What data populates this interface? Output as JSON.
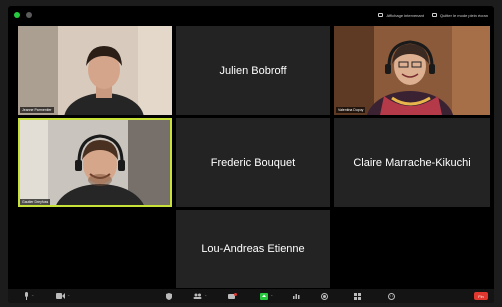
{
  "topbar": {
    "speaker_view_label": "Affichage intervenant",
    "exit_fullscreen_label": "Quitter le mode plein écran"
  },
  "participants": [
    {
      "name": "Jeanne Parmentier",
      "video": true
    },
    {
      "name": "Julien Bobroff",
      "video": false
    },
    {
      "name": "Valentina Dupuy",
      "video": true
    },
    {
      "name": "Gautier Dreyfuss",
      "video": true
    },
    {
      "name": "Frederic Bouquet",
      "video": false
    },
    {
      "name": "Claire Marrache-Kikuchi",
      "video": false
    },
    {
      "name": "Lou-Andreas Etienne",
      "video": false
    }
  ],
  "toolbar": {
    "end_label": "Fin"
  },
  "colors": {
    "active_speaker": "#c8e23a",
    "end_button": "#e0382e",
    "status_green": "#27c93f"
  }
}
